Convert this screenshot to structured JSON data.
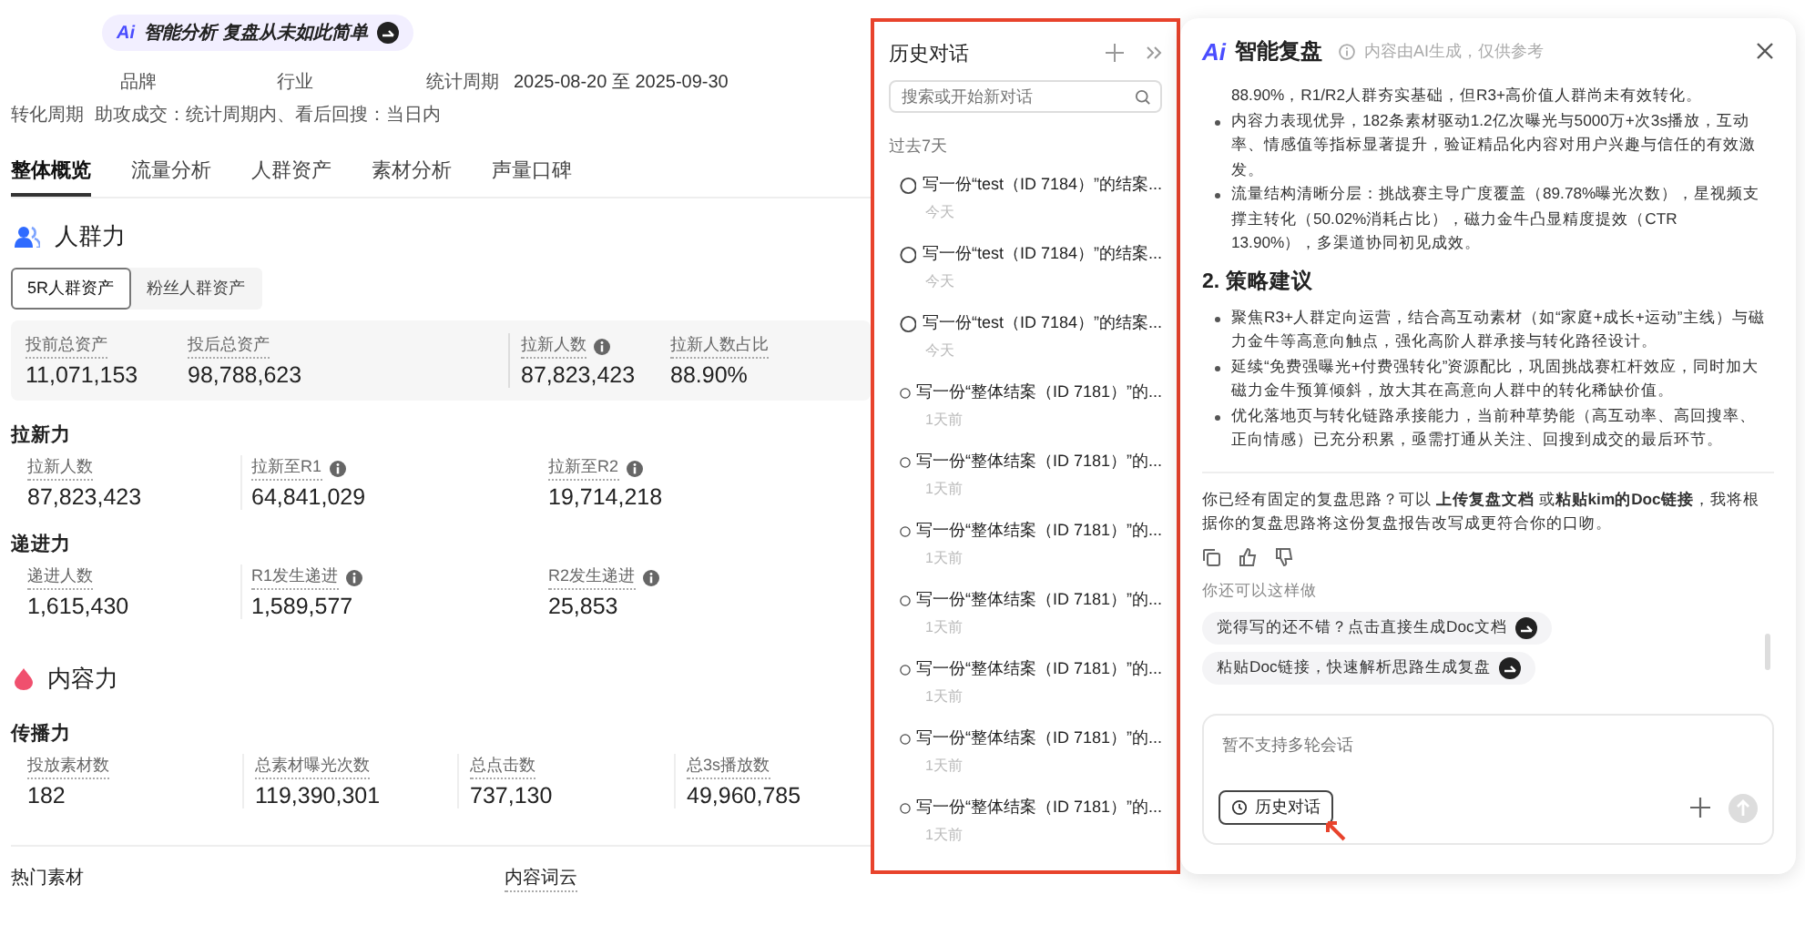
{
  "header": {
    "ai_logo": "Ai",
    "badge": "智能分析 复盘从未如此简单"
  },
  "meta": [
    {
      "label": "品牌"
    },
    {
      "label": "行业"
    },
    {
      "label": "统计周期",
      "value": "2025-08-20 至 2025-09-30"
    }
  ],
  "conversion": {
    "label": "转化周期",
    "value": "助攻成交：统计周期内、看后回搜：当日内"
  },
  "tabs": [
    {
      "label": "整体概览",
      "selected": true
    },
    {
      "label": "流量分析",
      "selected": false
    },
    {
      "label": "人群资产",
      "selected": false
    },
    {
      "label": "素材分析",
      "selected": false
    },
    {
      "label": "声量口碑",
      "selected": false
    }
  ],
  "crowd": {
    "title": "人群力",
    "subtabs": [
      {
        "label": "5R人群资产",
        "selected": true
      },
      {
        "label": "粉丝人群资产",
        "selected": false
      }
    ],
    "summary": [
      {
        "label": "投前总资产",
        "value": "11,071,153",
        "info": false
      },
      {
        "label": "投后总资产",
        "value": "98,788,623",
        "info": false
      },
      {
        "label": "拉新人数",
        "value": "87,823,423",
        "info": true
      },
      {
        "label": "拉新人数占比",
        "value": "88.90%",
        "info": false
      }
    ],
    "groups": [
      {
        "title": "拉新力",
        "stats": [
          {
            "label": "拉新人数",
            "value": "87,823,423",
            "info": false
          },
          {
            "label": "拉新至R1",
            "value": "64,841,029",
            "info": true
          },
          {
            "label": "拉新至R2",
            "value": "19,714,218",
            "info": true
          }
        ]
      },
      {
        "title": "递进力",
        "stats": [
          {
            "label": "递进人数",
            "value": "1,615,430",
            "info": false
          },
          {
            "label": "R1发生递进",
            "value": "1,589,577",
            "info": true
          },
          {
            "label": "R2发生递进",
            "value": "25,853",
            "info": true
          }
        ]
      }
    ]
  },
  "content": {
    "title": "内容力",
    "group": "传播力",
    "stats": [
      {
        "label": "投放素材数",
        "value": "182"
      },
      {
        "label": "总素材曝光次数",
        "value": "119,390,301"
      },
      {
        "label": "总点击数",
        "value": "737,130"
      },
      {
        "label": "总3s播放数",
        "value": "49,960,785"
      }
    ]
  },
  "bottom": [
    "热门素材",
    "内容词云"
  ],
  "history": {
    "title": "历史对话",
    "search_placeholder": "搜索或开始新对话",
    "group": "过去7天",
    "items": [
      {
        "title": "写一份“test（ID 7184）”的结案...",
        "time": "今天"
      },
      {
        "title": "写一份“test（ID 7184）”的结案...",
        "time": "今天"
      },
      {
        "title": "写一份“test（ID 7184）”的结案...",
        "time": "今天"
      },
      {
        "title": "写一份“整体结案（ID 7181）”的...",
        "time": "1天前"
      },
      {
        "title": "写一份“整体结案（ID 7181）”的...",
        "time": "1天前"
      },
      {
        "title": "写一份“整体结案（ID 7181）”的...",
        "time": "1天前"
      },
      {
        "title": "写一份“整体结案（ID 7181）”的...",
        "time": "1天前"
      },
      {
        "title": "写一份“整体结案（ID 7181）”的...",
        "time": "1天前"
      },
      {
        "title": "写一份“整体结案（ID 7181）”的...",
        "time": "1天前"
      },
      {
        "title": "写一份“整体结案（ID 7181）”的...",
        "time": "1天前"
      }
    ]
  },
  "assistant": {
    "logo": "Ai",
    "title": "智能复盘",
    "note": "内容由AI生成，仅供参考",
    "blocks": [
      {
        "kind": "text",
        "text": "88.90%，R1/R2人群夯实基础，但R3+高价值人群尚未有效转化。"
      },
      {
        "kind": "bullet",
        "text": "内容力表现优异，182条素材驱动1.2亿次曝光与5000万+次3s播放，互动率、情感值等指标显著提升，验证精品化内容对用户兴趣与信任的有效激发。"
      },
      {
        "kind": "bullet",
        "text": "流量结构清晰分层：挑战赛主导广度覆盖（89.78%曝光次数），星视频支撑主转化（50.02%消耗占比），磁力金牛凸显精度提效（CTR 13.90%），多渠道协同初见成效。"
      },
      {
        "kind": "heading",
        "text": "2. 策略建议"
      },
      {
        "kind": "bullet",
        "text": "聚焦R3+人群定向运营，结合高互动素材（如“家庭+成长+运动”主线）与磁力金牛等高意向触点，强化高阶人群承接与转化路径设计。"
      },
      {
        "kind": "bullet",
        "text": "延续“免费强曝光+付费强转化”资源配比，巩固挑战赛杠杆效应，同时加大磁力金牛预算倾斜，放大其在高意向人群中的转化稀缺价值。"
      },
      {
        "kind": "bullet",
        "text": "优化落地页与转化链路承接能力，当前种草势能（高互动率、高回搜率、正向情感）已充分积累，亟需打通从关注、回搜到成交的最后环节。"
      }
    ],
    "message": "你已经有固定的复盘思路？可以 **上传复盘文档** 或**粘贴kim的Doc链接**，我将根据你的复盘思路将这份复盘报告改写成更符合你的口吻。",
    "more_label": "你还可以这样做",
    "suggestions": [
      "觉得写的还不错？点击直接生成Doc文档",
      "粘贴Doc链接，快速解析思路生成复盘"
    ],
    "input_placeholder": "暂不支持多轮会话",
    "history_button": "历史对话"
  }
}
